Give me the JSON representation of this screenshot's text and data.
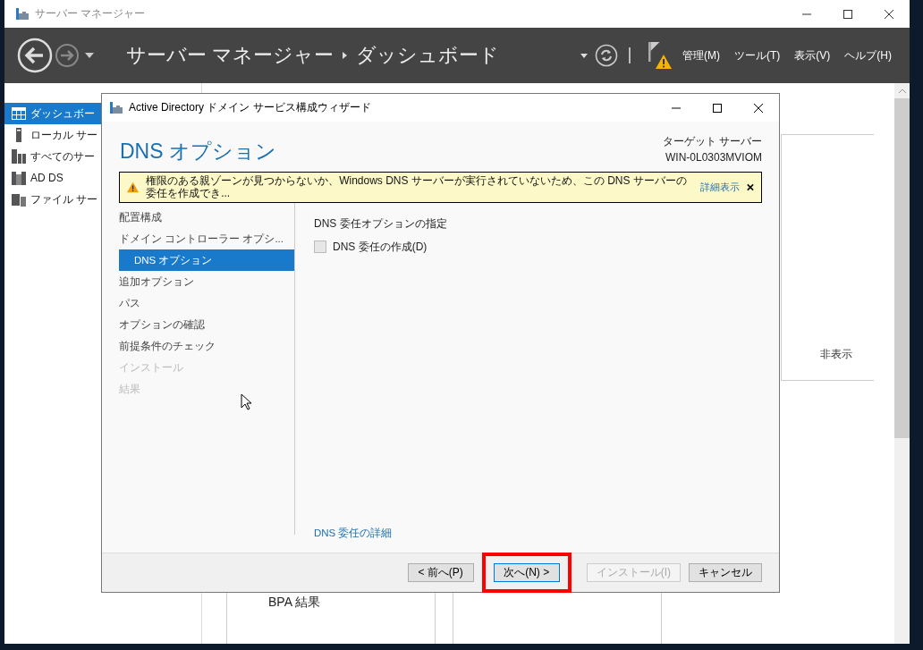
{
  "app_window": {
    "title": "サーバー マネージャー"
  },
  "header": {
    "breadcrumb_root": "サーバー マネージャー",
    "breadcrumb_page": "ダッシュボード",
    "menus": [
      "管理(M)",
      "ツール(T)",
      "表示(V)",
      "ヘルプ(H)"
    ]
  },
  "sidebar": {
    "items": [
      {
        "label": "ダッシュボー",
        "selected": true,
        "kind": "dashboard"
      },
      {
        "label": "ローカル サー",
        "selected": false,
        "kind": "server"
      },
      {
        "label": "すべてのサー",
        "selected": false,
        "kind": "servers"
      },
      {
        "label": "AD DS",
        "selected": false,
        "kind": "directory"
      },
      {
        "label": "ファイル サー",
        "selected": false,
        "kind": "files"
      }
    ]
  },
  "dashboard": {
    "hide_label": "非表示",
    "tile_title": "BPA 結果"
  },
  "wizard": {
    "title": "Active Directory ドメイン サービス構成ウィザード",
    "heading": "DNS オプション",
    "target_label": "ターゲット サーバー",
    "target_name": "WIN-0L0303MVIOM",
    "warning": {
      "message": "権限のある親ゾーンが見つからないか、Windows DNS サーバーが実行されていないため、この DNS サーバーの委任を作成でき...",
      "link": "詳細表示"
    },
    "steps": [
      {
        "label": "配置構成",
        "selected": false,
        "disabled": false
      },
      {
        "label": "ドメイン コントローラー オプシ...",
        "selected": false,
        "disabled": false,
        "children": [
          {
            "label": "DNS オプション",
            "selected": true,
            "disabled": false
          }
        ]
      },
      {
        "label": "追加オプション",
        "selected": false,
        "disabled": false
      },
      {
        "label": "パス",
        "selected": false,
        "disabled": false
      },
      {
        "label": "オプションの確認",
        "selected": false,
        "disabled": false
      },
      {
        "label": "前提条件のチェック",
        "selected": false,
        "disabled": false
      },
      {
        "label": "インストール",
        "selected": false,
        "disabled": true
      },
      {
        "label": "結果",
        "selected": false,
        "disabled": true
      }
    ],
    "section_title": "DNS 委任オプションの指定",
    "checkbox": {
      "label": "DNS 委任の作成(D)",
      "checked": false
    },
    "details_link": "DNS 委任の詳細",
    "buttons": [
      {
        "label": "< 前へ(P)",
        "disabled": false,
        "default": false,
        "highlighted": false
      },
      {
        "label": "次へ(N) >",
        "disabled": false,
        "default": true,
        "highlighted": true
      },
      {
        "label": "インストール(I)",
        "disabled": true,
        "default": false,
        "highlighted": false
      },
      {
        "label": "キャンセル",
        "disabled": false,
        "default": false,
        "highlighted": false
      }
    ]
  }
}
